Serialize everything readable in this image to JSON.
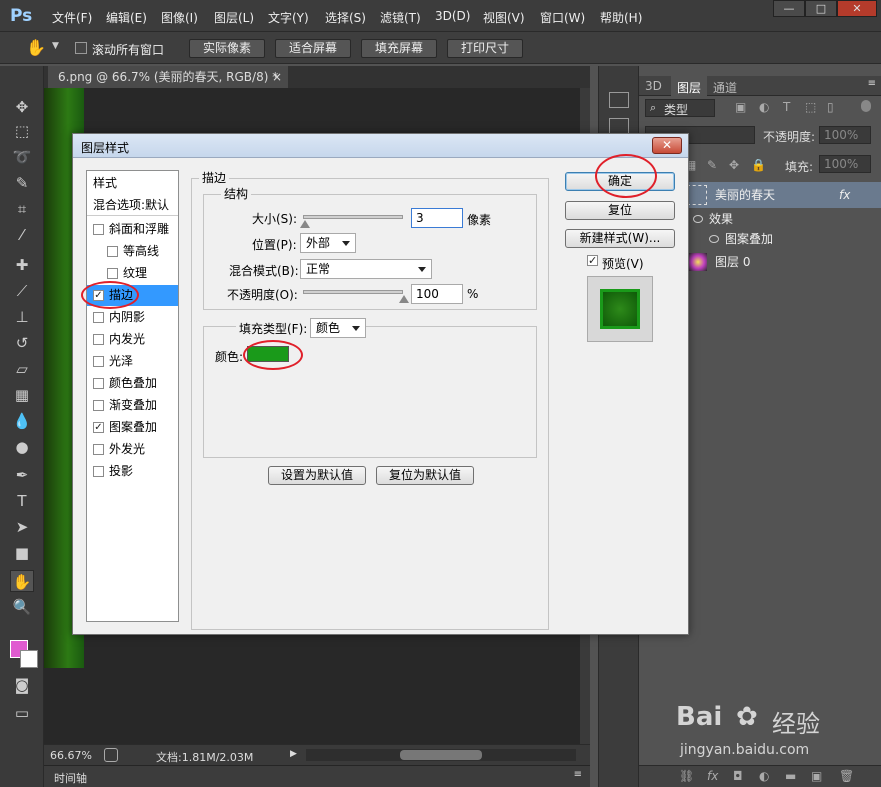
{
  "app": {
    "logo": "Ps"
  },
  "menu": [
    "文件(F)",
    "编辑(E)",
    "图像(I)",
    "图层(L)",
    "文字(Y)",
    "选择(S)",
    "滤镜(T)",
    "3D(D)",
    "视图(V)",
    "窗口(W)",
    "帮助(H)"
  ],
  "window_controls": {
    "minimize": "—",
    "maximize": "□",
    "close": "✕"
  },
  "options_bar": {
    "scroll_all_label": "滚动所有窗口",
    "buttons": [
      "实际像素",
      "适合屏幕",
      "填充屏幕",
      "打印尺寸"
    ]
  },
  "document": {
    "tab_title": "6.png @ 66.7% (美丽的春天, RGB/8) *",
    "tab_close": "×"
  },
  "status": {
    "zoom": "66.67%",
    "doc_info": "文档:1.81M/2.03M"
  },
  "timeline": {
    "label": "时间轴"
  },
  "layers_panel": {
    "tabs": [
      "3D",
      "图层",
      "通道"
    ],
    "filter_label": "类型",
    "opacity_label": "不透明度:",
    "opacity_value": "100%",
    "fill_label": "填充:",
    "fill_value": "100%",
    "layers": [
      {
        "name": "美丽的春天",
        "fx": "fx"
      },
      {
        "name": "效果"
      },
      {
        "name": "图案叠加"
      },
      {
        "name": "图层 0"
      }
    ]
  },
  "dialog": {
    "title": "图层样式",
    "close_label": "✕",
    "style_list": [
      {
        "label": "样式",
        "checkbox": false,
        "checked": false,
        "header": true
      },
      {
        "label": "混合选项:默认",
        "checkbox": false,
        "checked": false,
        "header": true
      },
      {
        "label": "斜面和浮雕",
        "checkbox": true,
        "checked": false
      },
      {
        "label": "等高线",
        "checkbox": true,
        "checked": false,
        "indent": true
      },
      {
        "label": "纹理",
        "checkbox": true,
        "checked": false,
        "indent": true
      },
      {
        "label": "描边",
        "checkbox": true,
        "checked": true,
        "selected": true
      },
      {
        "label": "内阴影",
        "checkbox": true,
        "checked": false
      },
      {
        "label": "内发光",
        "checkbox": true,
        "checked": false
      },
      {
        "label": "光泽",
        "checkbox": true,
        "checked": false
      },
      {
        "label": "颜色叠加",
        "checkbox": true,
        "checked": false
      },
      {
        "label": "渐变叠加",
        "checkbox": true,
        "checked": false
      },
      {
        "label": "图案叠加",
        "checkbox": true,
        "checked": true
      },
      {
        "label": "外发光",
        "checkbox": true,
        "checked": false
      },
      {
        "label": "投影",
        "checkbox": true,
        "checked": false
      }
    ],
    "section_title": "描边",
    "structure_title": "结构",
    "size_label": "大小(S):",
    "size_value": "3",
    "size_unit": "像素",
    "size_fraction": 0.01,
    "position_label": "位置(P):",
    "position_value": "外部",
    "blend_label": "混合模式(B):",
    "blend_value": "正常",
    "opacity_label": "不透明度(O):",
    "opacity_value": "100",
    "opacity_unit": "%",
    "opacity_fraction": 1.0,
    "fill_type_label": "填充类型(F):",
    "fill_type_value": "颜色",
    "color_label": "颜色:",
    "stroke_color": "#1a9a1a",
    "make_default": "设置为默认值",
    "reset_default": "复位为默认值",
    "ok": "确定",
    "reset": "复位",
    "new_style": "新建样式(W)...",
    "preview_label": "预览(V)",
    "preview_checked": true
  },
  "annotation_color": "#e0202a",
  "watermark": {
    "brand": "Bai",
    "brand2": "经验",
    "url": "jingyan.baidu.com"
  }
}
